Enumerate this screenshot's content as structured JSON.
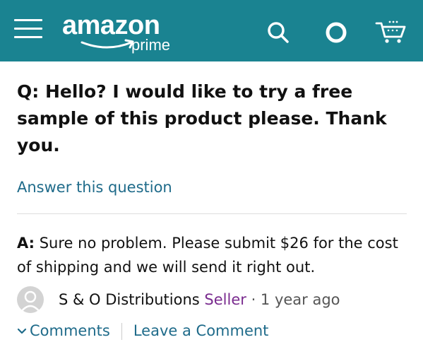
{
  "header": {
    "logo_word": "amazon",
    "logo_sub": "prime",
    "icons": [
      "menu-icon",
      "search-icon",
      "alexa-icon",
      "cart-icon"
    ],
    "background_color": "#1a8391"
  },
  "question": {
    "text": "Q: Hello? I would like to try a free sample of this product please. Thank you.",
    "answer_link": "Answer this question"
  },
  "answer": {
    "prefix": "A:",
    "text": " Sure no problem. Please submit $26 for the cost of shipping and we will send it right out.",
    "author": "S & O Distributions",
    "role": "Seller",
    "dot": " · ",
    "time": "1 year ago"
  },
  "comments": {
    "comments_label": "Comments",
    "leave_label": "Leave a Comment"
  },
  "colors": {
    "link": "#1f6b8a",
    "seller": "#7a2c8f"
  }
}
